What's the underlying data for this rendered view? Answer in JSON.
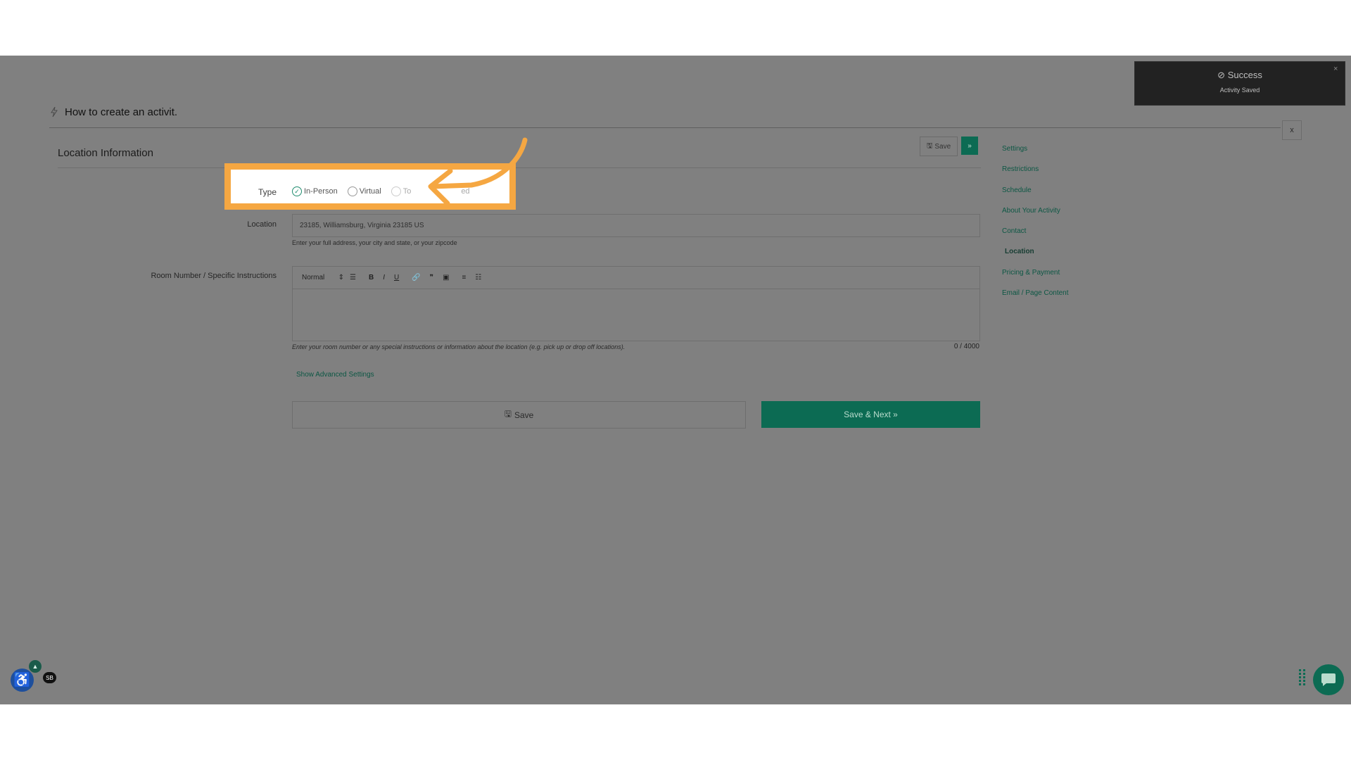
{
  "header": {
    "title": "How to create an activit.",
    "close_label": "x"
  },
  "section": {
    "title": "Location Information",
    "save_label": "Save",
    "next_label": "»"
  },
  "sidebar": {
    "items": [
      {
        "label": "Settings"
      },
      {
        "label": "Restrictions"
      },
      {
        "label": "Schedule"
      },
      {
        "label": "About Your Activity"
      },
      {
        "label": "Contact"
      },
      {
        "label": "Location",
        "active": true
      },
      {
        "label": "Pricing & Payment"
      },
      {
        "label": "Email / Page Content"
      }
    ]
  },
  "type_field": {
    "label": "Type",
    "options": [
      {
        "label": "In-Person",
        "checked": true
      },
      {
        "label": "Virtual",
        "checked": false
      },
      {
        "label": "To",
        "checked": false
      },
      {
        "label": "ed",
        "checked": false
      }
    ]
  },
  "location_field": {
    "label": "Location",
    "value": "23185, Williamsburg, Virginia 23185 US",
    "help": "Enter your full address, your city and state, or your zipcode"
  },
  "room_field": {
    "label": "Room Number / Specific Instructions",
    "format_value": "Normal",
    "help": "Enter your room number or any special instructions or information about the location (e.g. pick up or drop off locations).",
    "counter": "0 / 4000"
  },
  "advanced_link": "Show Advanced Settings",
  "footer_buttons": {
    "save_label": "Save",
    "next_label": "Save & Next »"
  },
  "toast": {
    "title": "Success",
    "message": "Activity Saved",
    "close": "×"
  },
  "widgets": {
    "badge": "SB"
  },
  "colors": {
    "accent": "#0c6b53",
    "highlight": "#f5a742",
    "overlay": "#808080"
  }
}
